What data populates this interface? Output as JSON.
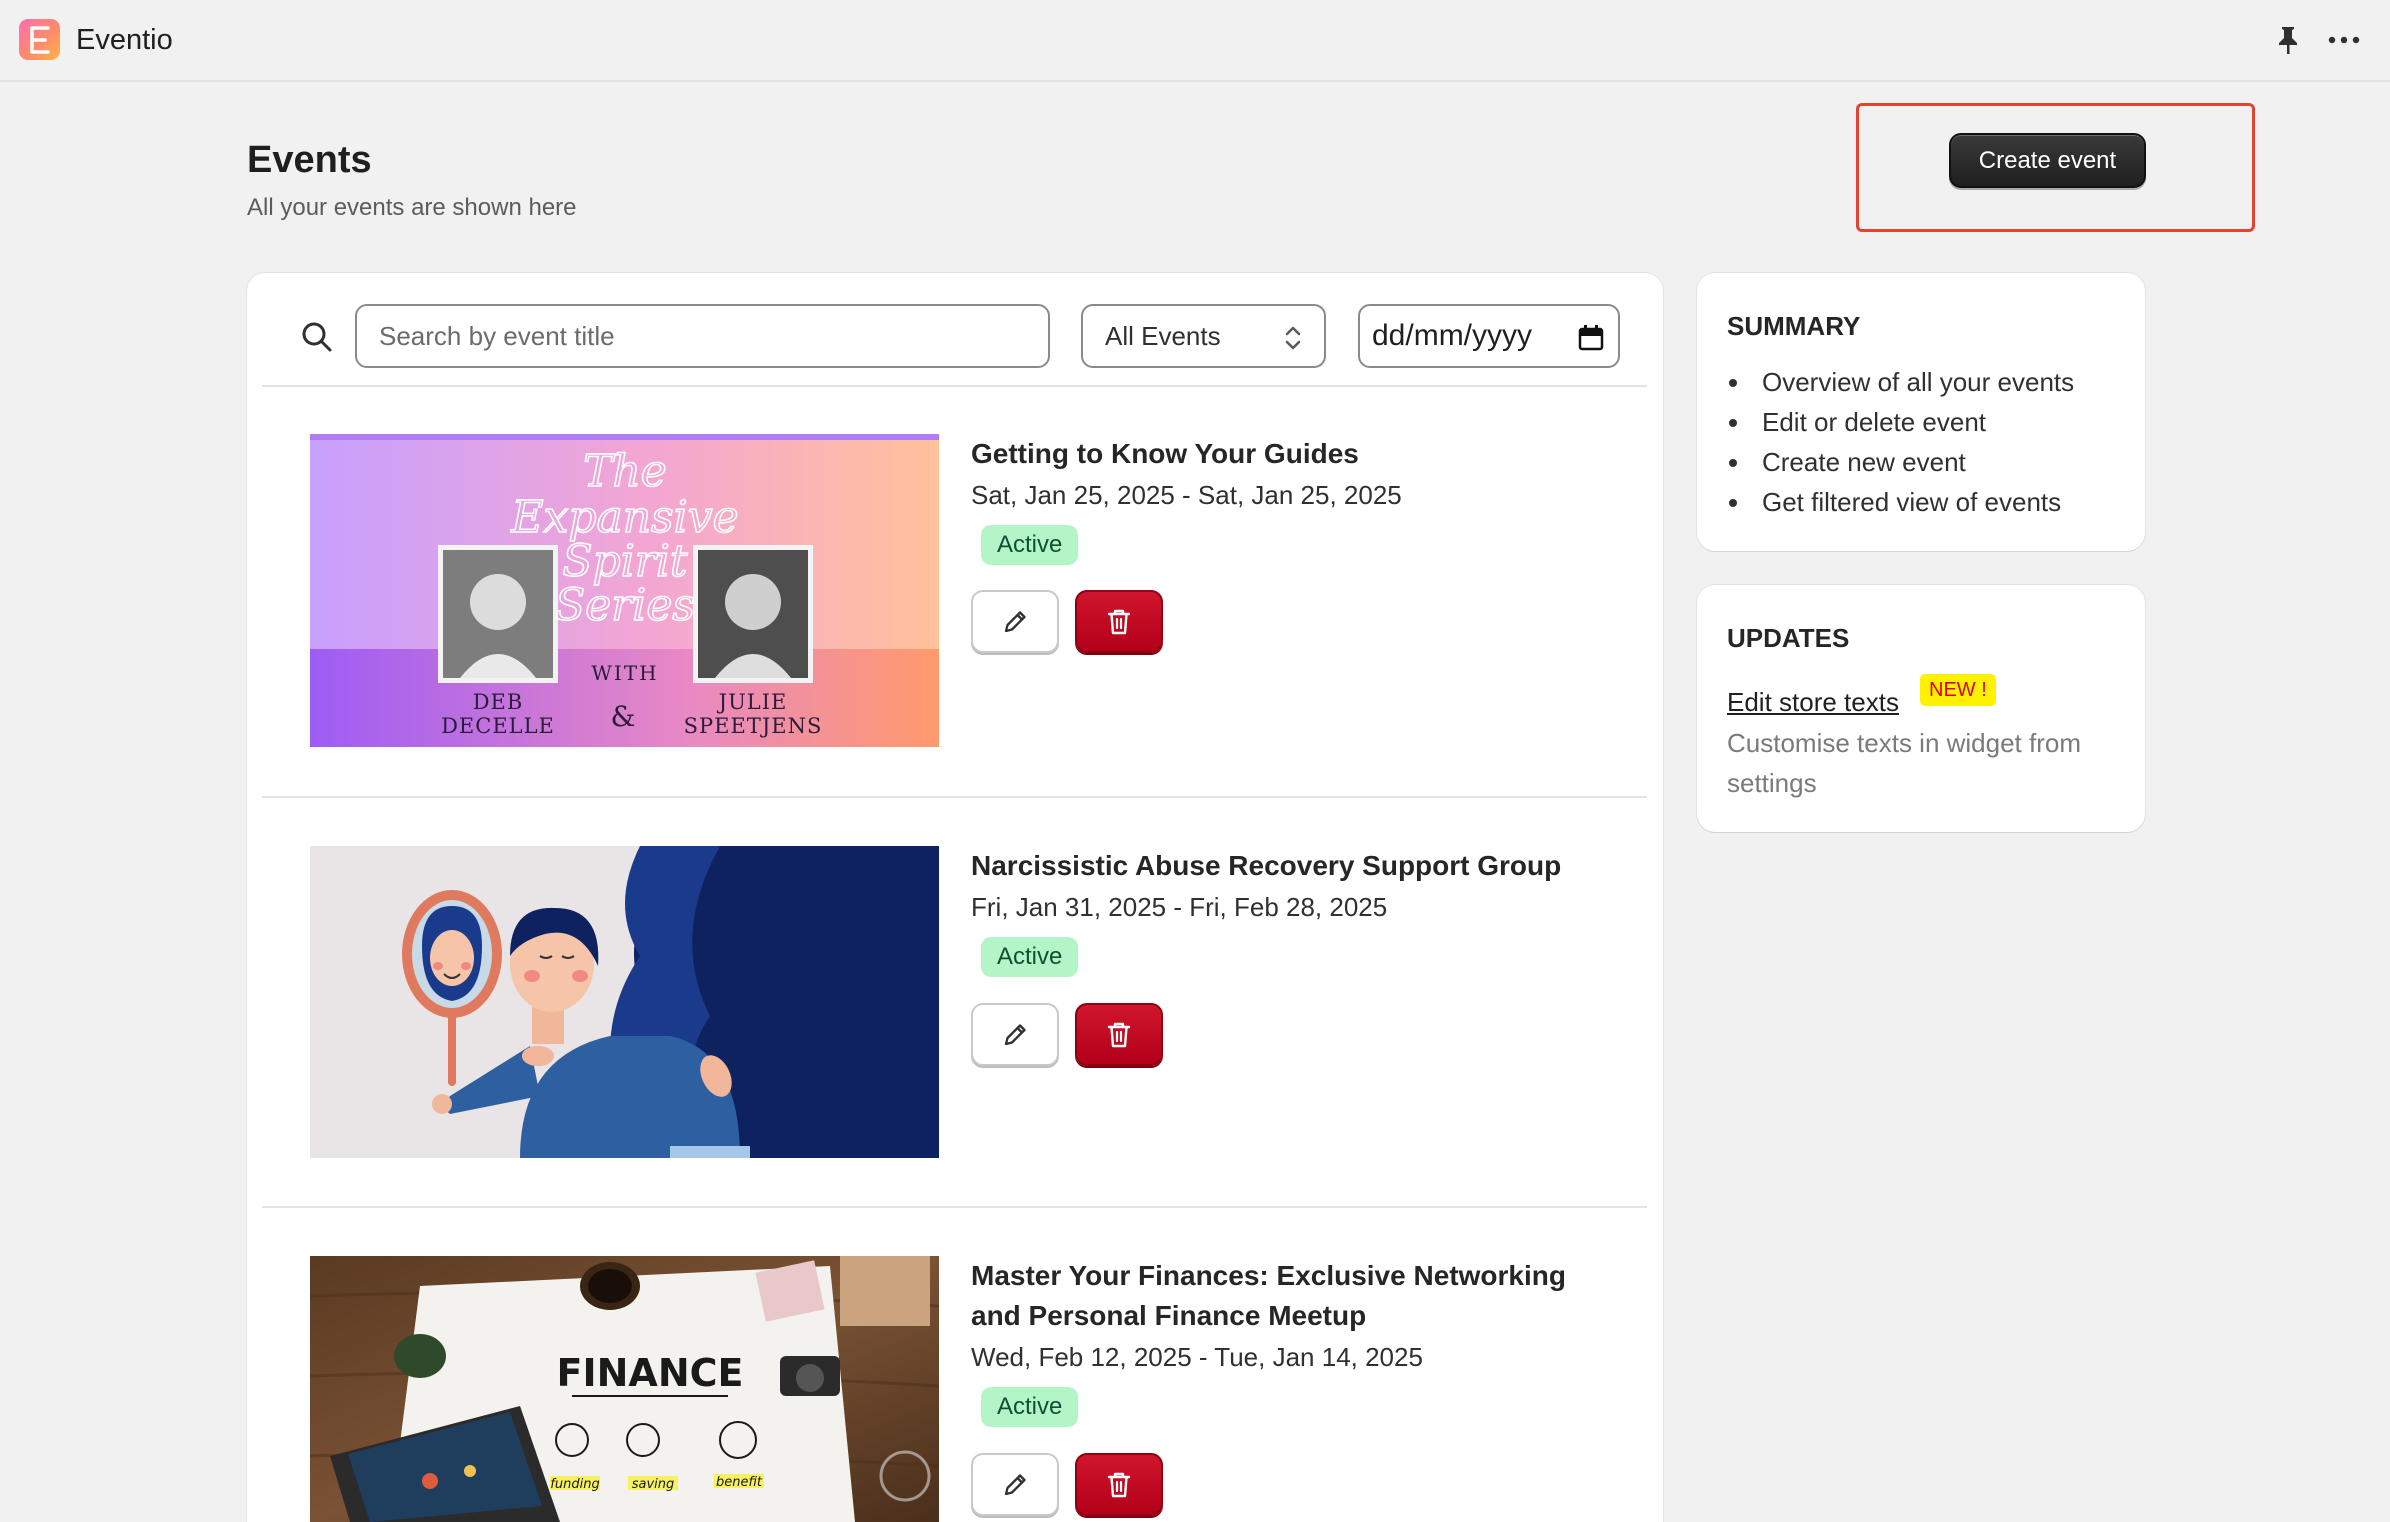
{
  "app": {
    "name": "Eventio",
    "logo_letter": "E",
    "icons": [
      "pin-icon",
      "more-icon"
    ]
  },
  "header": {
    "title": "Events",
    "subtitle": "All your events are shown here",
    "create_label": "Create event"
  },
  "filters": {
    "search_placeholder": "Search by event title",
    "search_value": "",
    "type_selected": "All Events",
    "date_placeholder": "dd/mm/yyyy"
  },
  "events": [
    {
      "title": "Getting to Know Your Guides",
      "dates": "Sat, Jan 25, 2025 - Sat, Jan 25, 2025",
      "status": "Active",
      "banner": {
        "line1": "The",
        "line2": "Expansive",
        "line3": "Spirit",
        "line4": "Series",
        "with": "WITH",
        "amp": "&",
        "left_name_1": "DEB",
        "left_name_2": "DECELLE",
        "right_name_1": "JULIE",
        "right_name_2": "SPEETJENS"
      }
    },
    {
      "title": "Narcissistic Abuse Recovery Support Group",
      "dates": "Fri, Jan 31, 2025 - Fri, Feb 28, 2025",
      "status": "Active"
    },
    {
      "title_line1": "Master Your Finances: Exclusive Networking",
      "title_line2": "and Personal Finance Meetup",
      "dates": "Wed, Feb 12, 2025 - Tue, Jan 14, 2025",
      "status": "Active",
      "banner": {
        "heading": "FINANCE",
        "label1": "funding",
        "label2": "saving",
        "label3": "benefit"
      }
    }
  ],
  "summary": {
    "heading": "SUMMARY",
    "items": [
      "Overview of all your events",
      "Edit or delete event",
      "Create new event",
      "Get filtered view of events"
    ]
  },
  "updates": {
    "heading": "UPDATES",
    "link": "Edit store texts",
    "badge": "NEW !",
    "description": "Customise texts in widget from settings"
  },
  "colors": {
    "accent_dark": "#1f1f1f",
    "active_badge_bg": "#b4f5c8",
    "danger": "#c4071f",
    "highlight": "#e2452f",
    "new_badge_bg": "#fff200"
  }
}
